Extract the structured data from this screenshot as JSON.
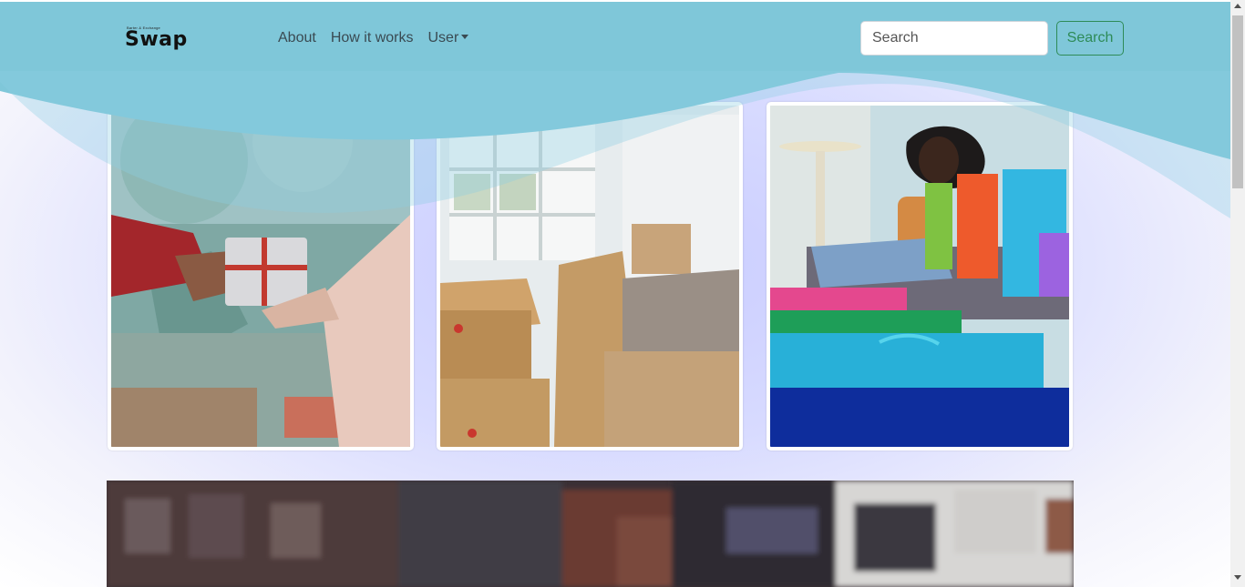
{
  "brand": {
    "tagline": "Barter & Exchange",
    "name": "Swap"
  },
  "nav": {
    "links": [
      {
        "label": "About"
      },
      {
        "label": "How it works"
      },
      {
        "label": "User"
      }
    ]
  },
  "search": {
    "placeholder": "Search",
    "button_label": "Search"
  },
  "colors": {
    "navbar": "#7fc7d9",
    "search_button": "#2e8b57",
    "background_glow": "#c9ccff"
  },
  "cards": [
    {
      "image": "gift-exchange-photo"
    },
    {
      "image": "moving-boxes-photo"
    },
    {
      "image": "shopping-bags-photo"
    }
  ],
  "banner": {
    "image": "blurred-street-photo"
  }
}
